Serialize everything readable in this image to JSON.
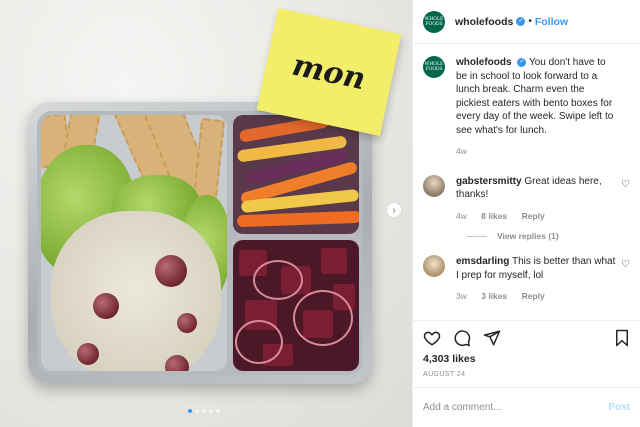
{
  "post": {
    "author": "wholefoods",
    "follow_label": "Follow",
    "logo_text": [
      "WHOLE",
      "FOODS"
    ],
    "sticky_note_text": "mon",
    "caption": "You don't have to be in school to look forward to a lunch break. Charm even the pickiest eaters with bento boxes for every day of the week. Swipe left to see what's for lunch.",
    "caption_time": "4w",
    "carousel": {
      "total": 5,
      "current": 1
    }
  },
  "comments": [
    {
      "user": "gabstersmitty",
      "text": "Great ideas here, thanks!",
      "time": "4w",
      "likes": "8 likes",
      "reply": "Reply"
    },
    {
      "user": "emsdarling",
      "text": "This is better than what I prep for myself, lol",
      "time": "3w",
      "likes": "3 likes",
      "reply": "Reply"
    }
  ],
  "view_replies": "View replies (1)",
  "likes": "4,303 likes",
  "date": "AUGUST 24",
  "add_comment": {
    "placeholder": "Add a comment...",
    "post_label": "Post"
  },
  "colors": {
    "accent": "#3897f0",
    "brand": "#00674b",
    "note": "#f3ee6a"
  }
}
